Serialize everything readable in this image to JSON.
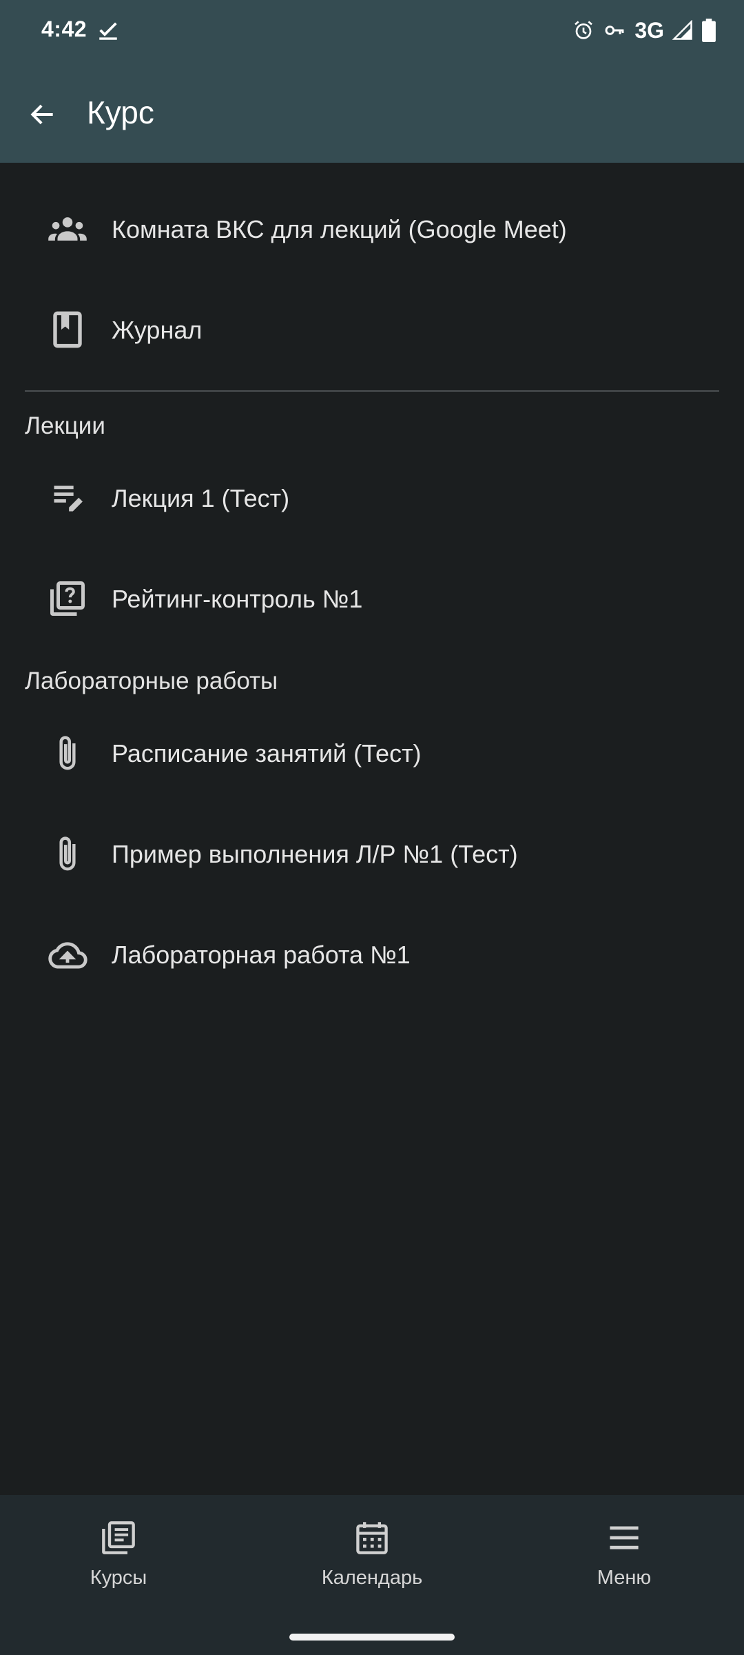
{
  "status_bar": {
    "time": "4:42",
    "network": "3G",
    "icons": [
      "check-icon",
      "alarm-icon",
      "vpn-key-icon",
      "signal-icon",
      "battery-icon"
    ]
  },
  "app_bar": {
    "title": "Курс",
    "back_icon": "arrow-back-icon"
  },
  "items": [
    {
      "label": "Комната ВКС для лекций (Google Meet)",
      "icon": "group-icon"
    },
    {
      "label": "Журнал",
      "icon": "book-icon"
    }
  ],
  "sections": [
    {
      "title": "Лекции",
      "items": [
        {
          "label": "Лекция 1 (Тест)",
          "icon": "edit-note-icon"
        },
        {
          "label": "Рейтинг-контроль №1",
          "icon": "quiz-icon"
        }
      ]
    },
    {
      "title": "Лабораторные работы",
      "items": [
        {
          "label": "Расписание занятий (Тест)",
          "icon": "attachment-icon"
        },
        {
          "label": "Пример выполнения Л/Р №1 (Тест)",
          "icon": "attachment-icon"
        },
        {
          "label": "Лабораторная работа №1",
          "icon": "cloud-upload-icon"
        }
      ]
    }
  ],
  "bottom_nav": [
    {
      "label": "Курсы",
      "icon": "courses-icon"
    },
    {
      "label": "Календарь",
      "icon": "calendar-icon"
    },
    {
      "label": "Меню",
      "icon": "menu-icon"
    }
  ],
  "colors": {
    "app_bar": "#354c52",
    "background": "#1b1e1f",
    "bottom_nav": "#222a2e",
    "text": "#e6e6e6"
  }
}
